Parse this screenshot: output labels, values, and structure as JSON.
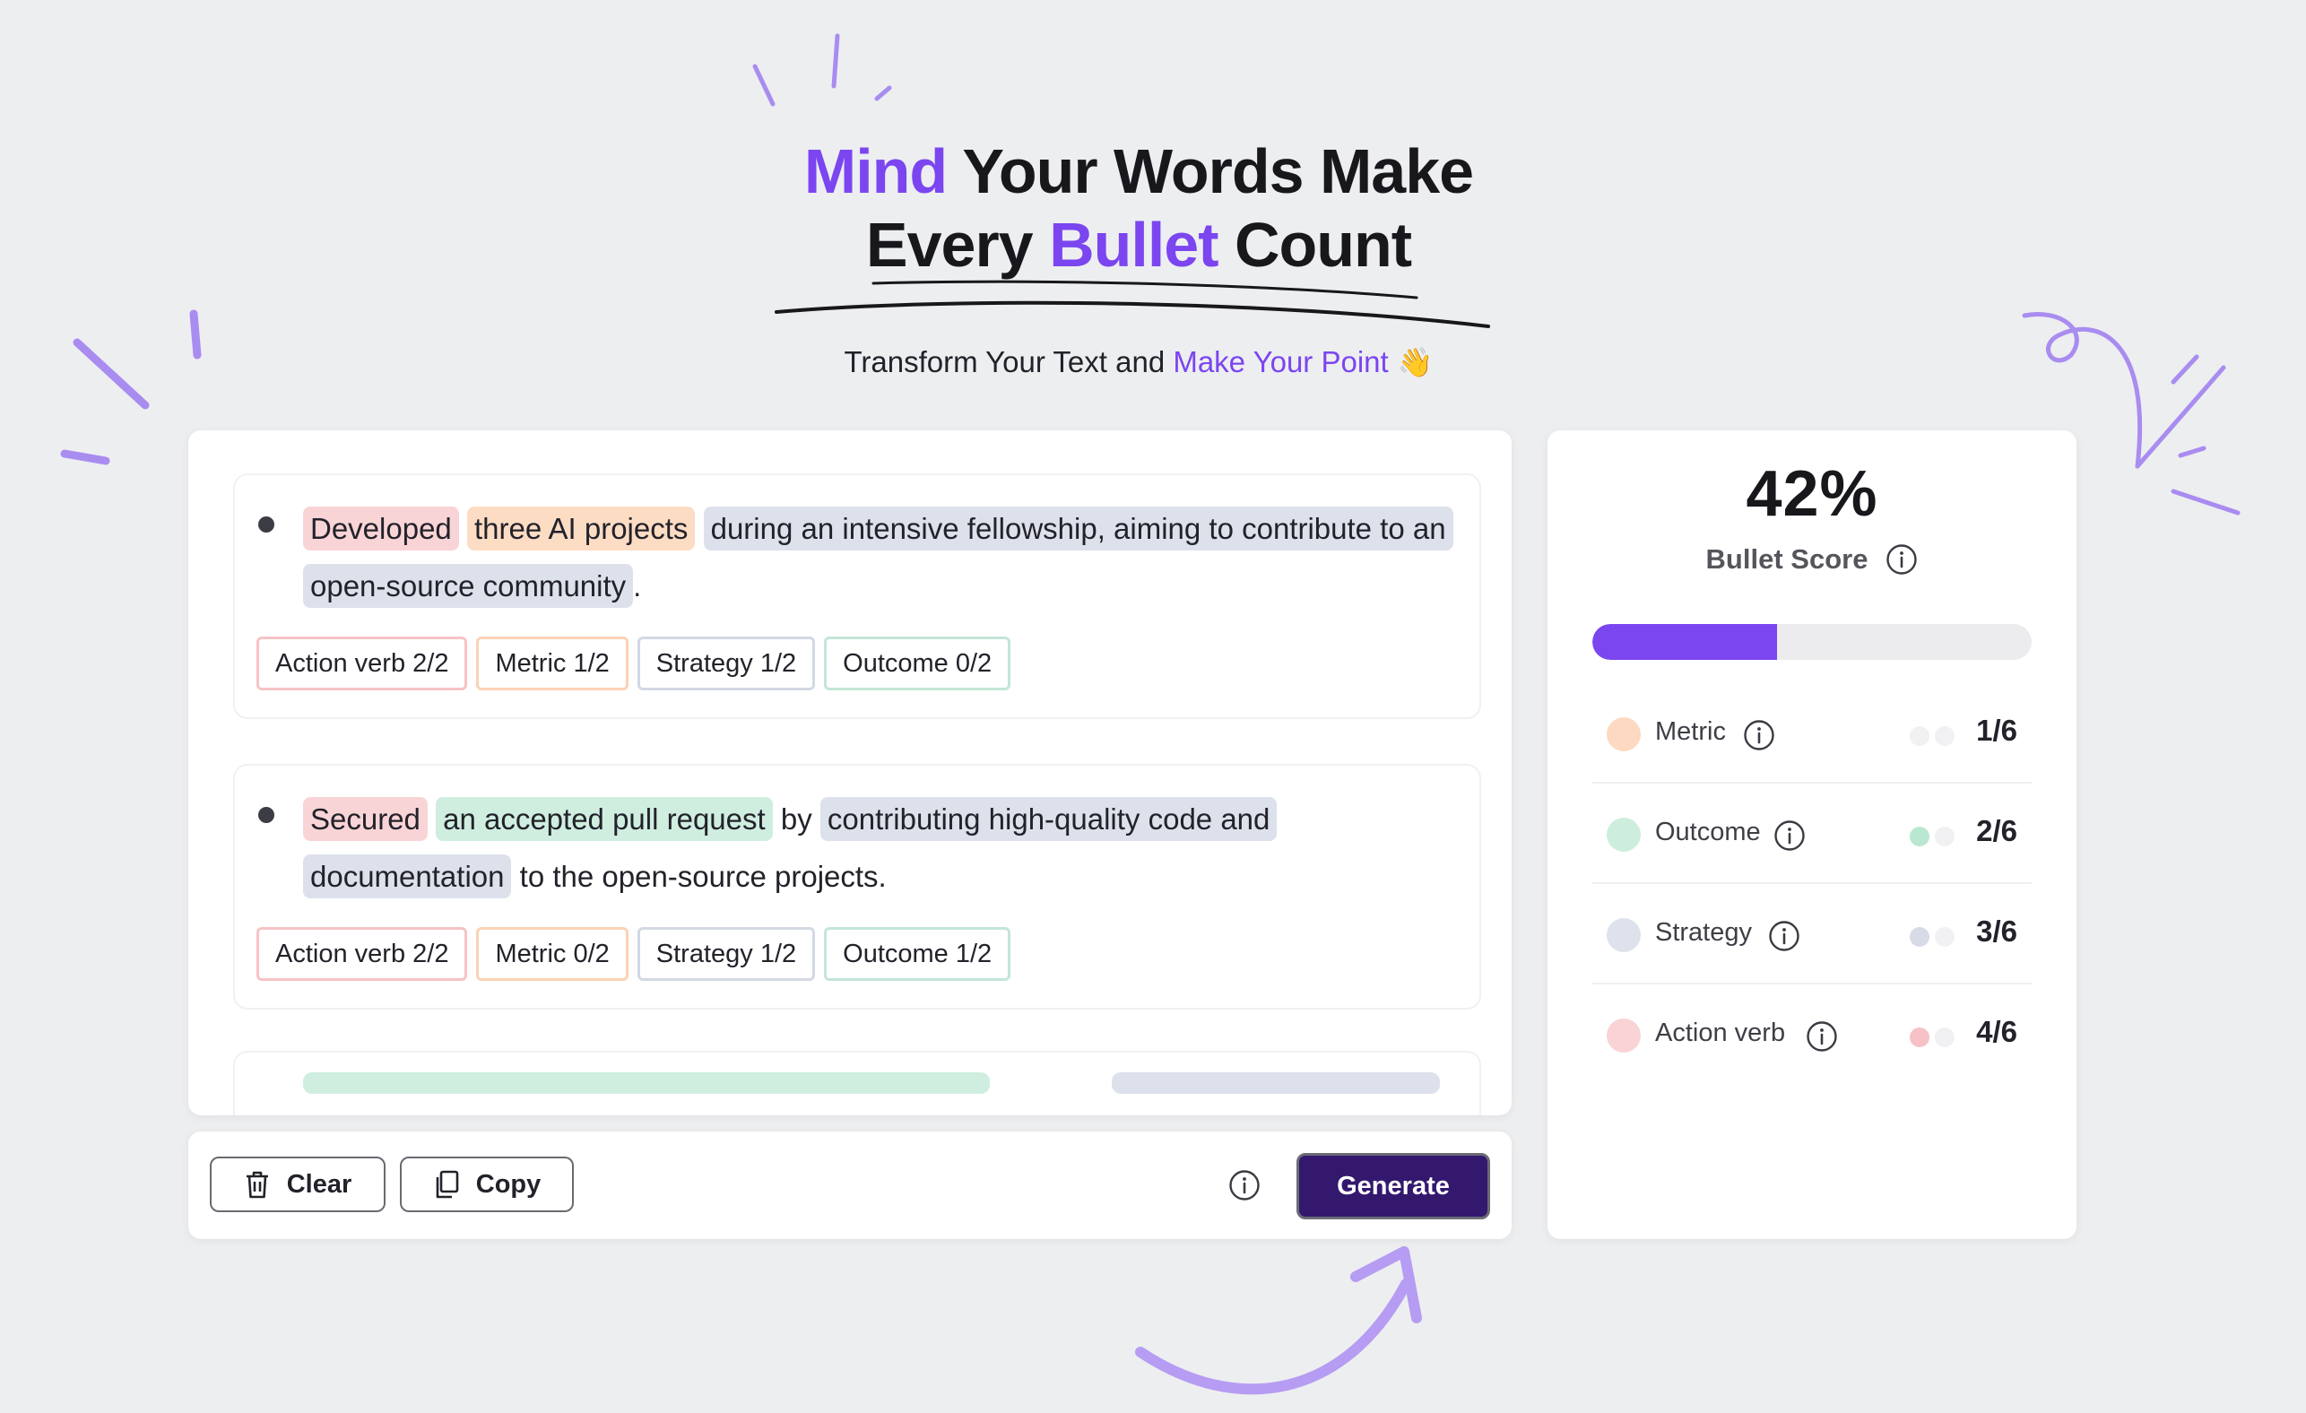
{
  "hero": {
    "title_accent_1": "Mind",
    "title_part_1": " Your Words Make",
    "title_part_2": "Every ",
    "title_accent_2": "Bullet",
    "title_part_3": " Count",
    "subtitle_plain": "Transform Your Text and ",
    "subtitle_accent": "Make Your Point",
    "subtitle_emoji": "👋",
    "accent_color": "#7b45f0"
  },
  "bullets": [
    {
      "segments": [
        {
          "text": "Developed",
          "type": "action-verb"
        },
        {
          "text": "three AI projects",
          "type": "metric"
        },
        {
          "text": "during an intensive fellowship, aiming to contribute to an open-source community",
          "type": "strategy"
        },
        {
          "text": ".",
          "type": "plain"
        }
      ],
      "tags": [
        {
          "label": "Action verb 2/2",
          "type": "action-verb"
        },
        {
          "label": "Metric 1/2",
          "type": "metric"
        },
        {
          "label": "Strategy 1/2",
          "type": "strategy"
        },
        {
          "label": "Outcome 0/2",
          "type": "outcome"
        }
      ]
    },
    {
      "segments": [
        {
          "text": "Secured",
          "type": "action-verb"
        },
        {
          "text": "an accepted pull request",
          "type": "outcome"
        },
        {
          "text": "by",
          "type": "plain"
        },
        {
          "text": "contributing high-quality code and documentation",
          "type": "strategy"
        },
        {
          "text": "to the open-source projects.",
          "type": "plain"
        }
      ],
      "tags": [
        {
          "label": "Action verb 2/2",
          "type": "action-verb"
        },
        {
          "label": "Metric 0/2",
          "type": "metric"
        },
        {
          "label": "Strategy 1/2",
          "type": "strategy"
        },
        {
          "label": "Outcome 1/2",
          "type": "outcome"
        }
      ]
    }
  ],
  "toolbar": {
    "clear_label": "Clear",
    "copy_label": "Copy",
    "generate_label": "Generate"
  },
  "score": {
    "percent_text": "42%",
    "progress_fraction": 0.42,
    "label": "Bullet Score",
    "metrics": [
      {
        "label": "Metric",
        "value": "1/6",
        "color": "#fdd9c2",
        "pips": [
          "#f1f1f3",
          "#f1f1f3"
        ]
      },
      {
        "label": "Outcome",
        "value": "2/6",
        "color": "#cdeedd",
        "pips": [
          "#b9e7d1",
          "#f1f1f3"
        ]
      },
      {
        "label": "Strategy",
        "value": "3/6",
        "color": "#dde2ec",
        "pips": [
          "#d6dbe7",
          "#f1f1f3"
        ]
      },
      {
        "label": "Action verb",
        "value": "4/6",
        "color": "#f9d3d5",
        "pips": [
          "#f6c2c5",
          "#f1f1f3"
        ]
      }
    ]
  },
  "colors": {
    "action_verb": "#f9d4d6",
    "metric": "#fddcc4",
    "strategy": "#dde1ec",
    "outcome": "#cfeee0",
    "generate_bg": "#33186e"
  }
}
